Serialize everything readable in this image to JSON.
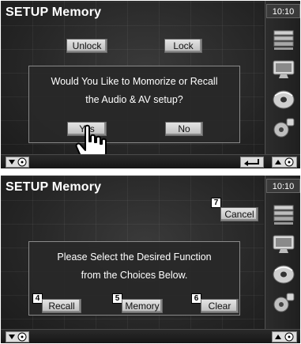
{
  "screen1": {
    "title": "SETUP Memory",
    "clock": "10:10",
    "unlock_label": "Unlock",
    "lock_label": "Lock",
    "message_line1": "Would You Like to Momorize or Recall",
    "message_line2": "the Audio & AV setup?",
    "yes_label": "Yes",
    "no_label": "No"
  },
  "screen2": {
    "title": "SETUP Memory",
    "clock": "10:10",
    "cancel_label": "Cancel",
    "cancel_badge": "7",
    "message_line1": "Please Select the Desired Function",
    "message_line2": "from the Choices Below.",
    "recall_label": "Recall",
    "recall_badge": "4",
    "memory_label": "Memory",
    "memory_badge": "5",
    "clear_label": "Clear",
    "clear_badge": "6"
  },
  "rail_icons": [
    "audio-stack-icon",
    "display-icon",
    "disc-icon",
    "speaker-icon"
  ],
  "colors": {
    "screen_bg": "#1b1b1b",
    "text": "#ffffff",
    "button_face": "#d0d0d0"
  }
}
